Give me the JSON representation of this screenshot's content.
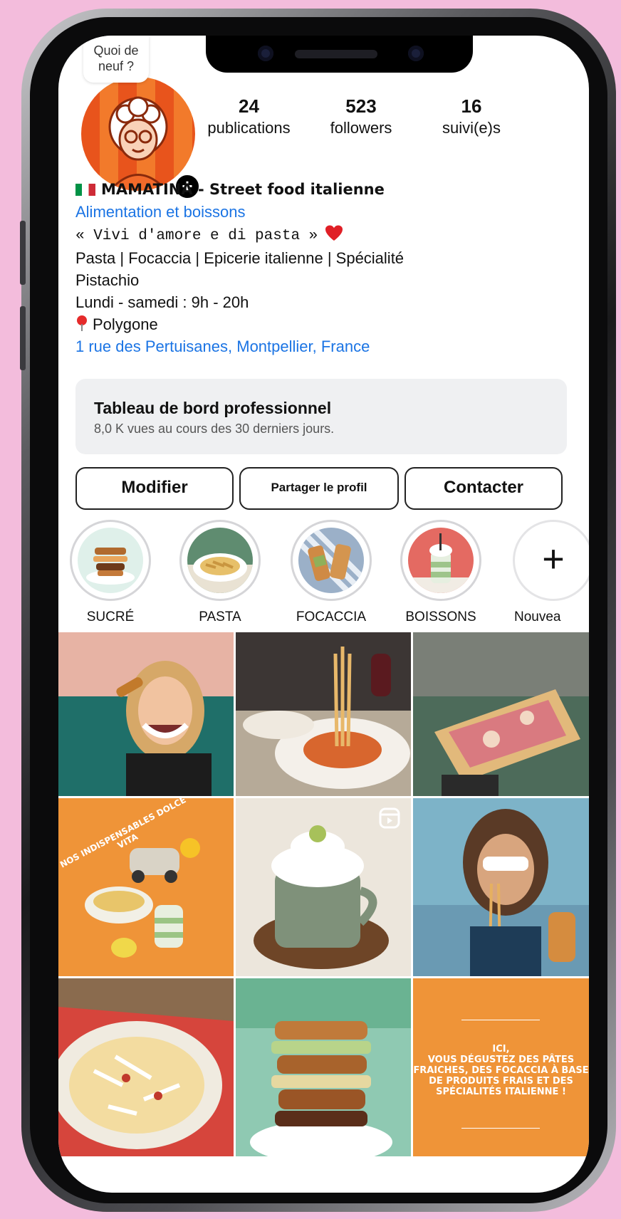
{
  "bubble": {
    "line1": "Quoi de",
    "line2": "neuf ?"
  },
  "stats": [
    {
      "value": "24",
      "label": "publications"
    },
    {
      "value": "523",
      "label": "followers"
    },
    {
      "value": "16",
      "label": "suivi(e)s"
    }
  ],
  "bio": {
    "name": "MAMATINA - Street food italienne",
    "category": "Alimentation et boissons",
    "quote": "« Vivi d'amore e di pasta »",
    "line1": "Pasta | Focaccia | Epicerie italienne | Spécialité",
    "line2": "Pistachio",
    "hours": "Lundi - samedi : 9h - 20h",
    "location": "Polygone",
    "address": "1 rue des Pertuisanes, Montpellier, France"
  },
  "dashboard": {
    "title": "Tableau de bord professionnel",
    "subtitle": "8,0 K vues au cours des 30 derniers jours."
  },
  "buttons": {
    "edit": "Modifier",
    "share": "Partager le profil",
    "contact": "Contacter"
  },
  "highlights": [
    "SUCRÉ",
    "PASTA",
    "FOCACCIA",
    "BOISSONS",
    "Nouvea"
  ],
  "posts": {
    "dolce_vita": "NOS INDISPENSABLES DOLCE VITA",
    "info_lines": [
      "ICI,",
      "VOUS DÉGUSTEZ DES PÂTES",
      "FRAICHES, DES FOCACCIA À BASE",
      "DE PRODUITS FRAIS ET DES",
      "SPÉCIALITÉS ITALIENNE !"
    ]
  },
  "colors": {
    "accent_blue": "#1b74e4",
    "post_orange": "#ef9438",
    "background_pink": "#f3bcdc"
  },
  "icons": [
    "plus-icon",
    "heart-icon",
    "location-pin-icon",
    "reel-icon",
    "flag-italy-icon"
  ]
}
